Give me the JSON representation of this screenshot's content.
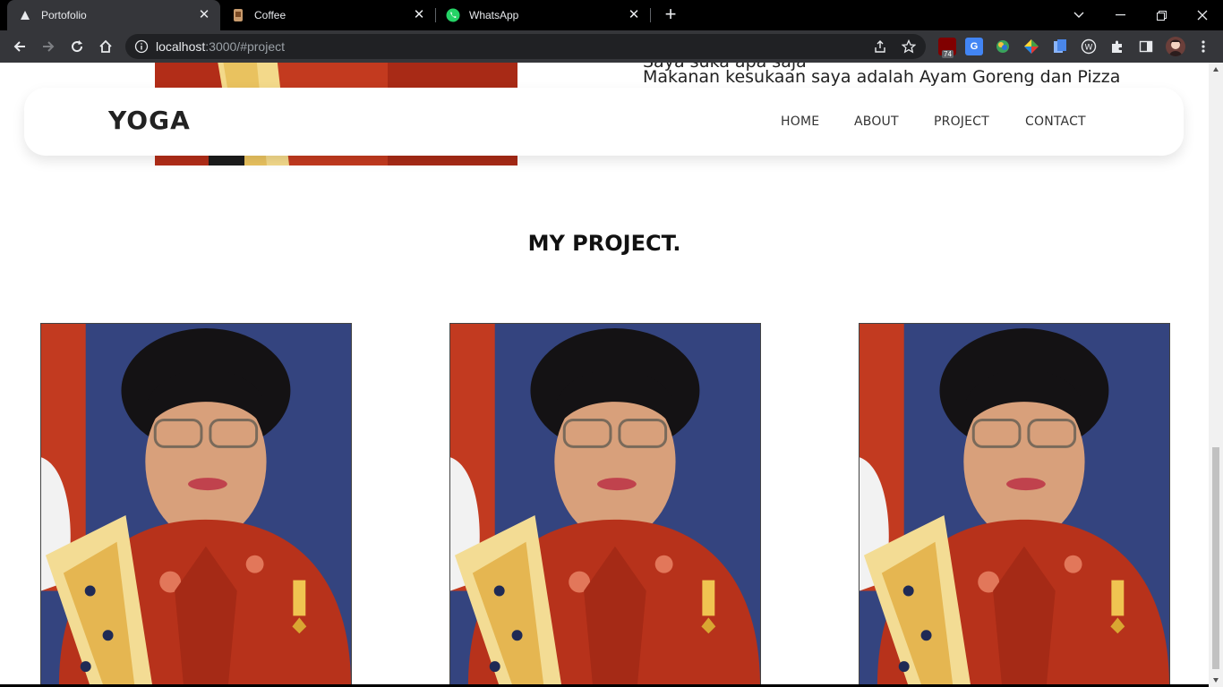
{
  "browser": {
    "tabs": [
      {
        "title": "Portofolio",
        "icon": "vercel-icon",
        "active": true
      },
      {
        "title": "Coffee",
        "icon": "coffee-icon",
        "active": false
      },
      {
        "title": "WhatsApp",
        "icon": "whatsapp-icon",
        "active": false
      }
    ],
    "url_host": "localhost",
    "url_rest": ":3000/#project",
    "extensions": [
      "ublock-icon",
      "google-translate-icon",
      "color-picker-icon",
      "colorzilla-icon",
      "docs-icon",
      "wappalyzer-icon",
      "puzzle-icon",
      "sidebar-icon",
      "profile-avatar"
    ],
    "ublock_badge": "74"
  },
  "page": {
    "about_line_partial": "Saya suka apa saja",
    "about_line": "Makanan kesukaan saya adalah Ayam Goreng dan Pizza",
    "nav": {
      "brand": "YOGA",
      "links": [
        "HOME",
        "ABOUT",
        "PROJECT",
        "CONTACT"
      ]
    },
    "project_title": "MY PROJECT.",
    "projects": [
      {
        "image": "portrait-photo"
      },
      {
        "image": "portrait-photo"
      },
      {
        "image": "portrait-photo"
      }
    ]
  },
  "colors": {
    "tabbar": "#000000",
    "toolbar": "#35363a",
    "omnibox": "#202124",
    "portrait_bg": "#2f3f78",
    "portrait_red": "#b8321a"
  }
}
